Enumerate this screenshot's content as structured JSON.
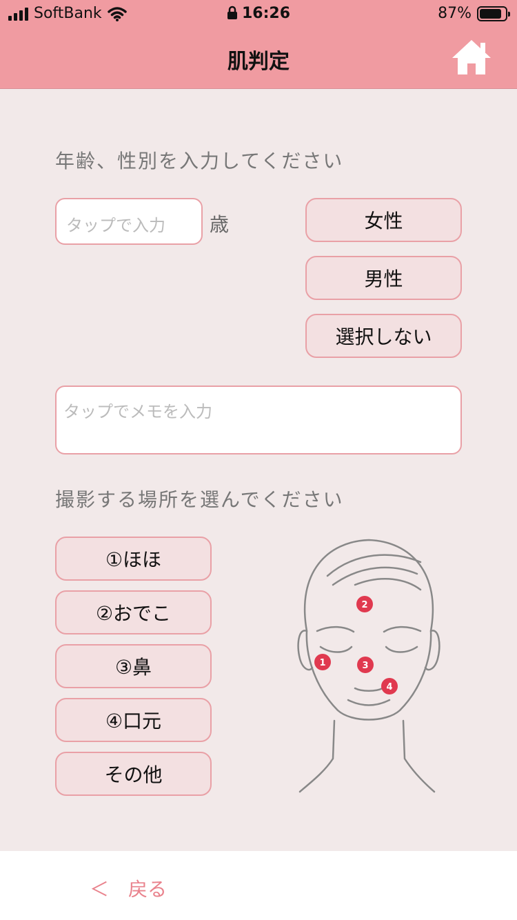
{
  "status_bar": {
    "carrier": "SoftBank",
    "time": "16:26",
    "battery_level": 0.87,
    "battery_text": "87%"
  },
  "nav": {
    "title": "肌判定",
    "home_icon": "home-icon"
  },
  "age_gender": {
    "label": "年齢、性別を入力してください",
    "age_placeholder": "タップで入力",
    "age_unit": "歳",
    "genders": [
      "女性",
      "男性",
      "選択しない"
    ]
  },
  "memo": {
    "placeholder": "タップでメモを入力"
  },
  "location": {
    "label": "撮影する場所を選んでください",
    "options": [
      "①ほほ",
      "②おでこ",
      "③鼻",
      "④口元",
      "その他"
    ],
    "markers": [
      "1",
      "2",
      "3",
      "4"
    ]
  },
  "footer": {
    "back_arrow": "＜",
    "back_label": "戻る"
  },
  "colors": {
    "accent": "#f09ba1",
    "marker": "#e0394f",
    "pill_bg": "#f3e0e1",
    "border": "#e9a0a6"
  }
}
